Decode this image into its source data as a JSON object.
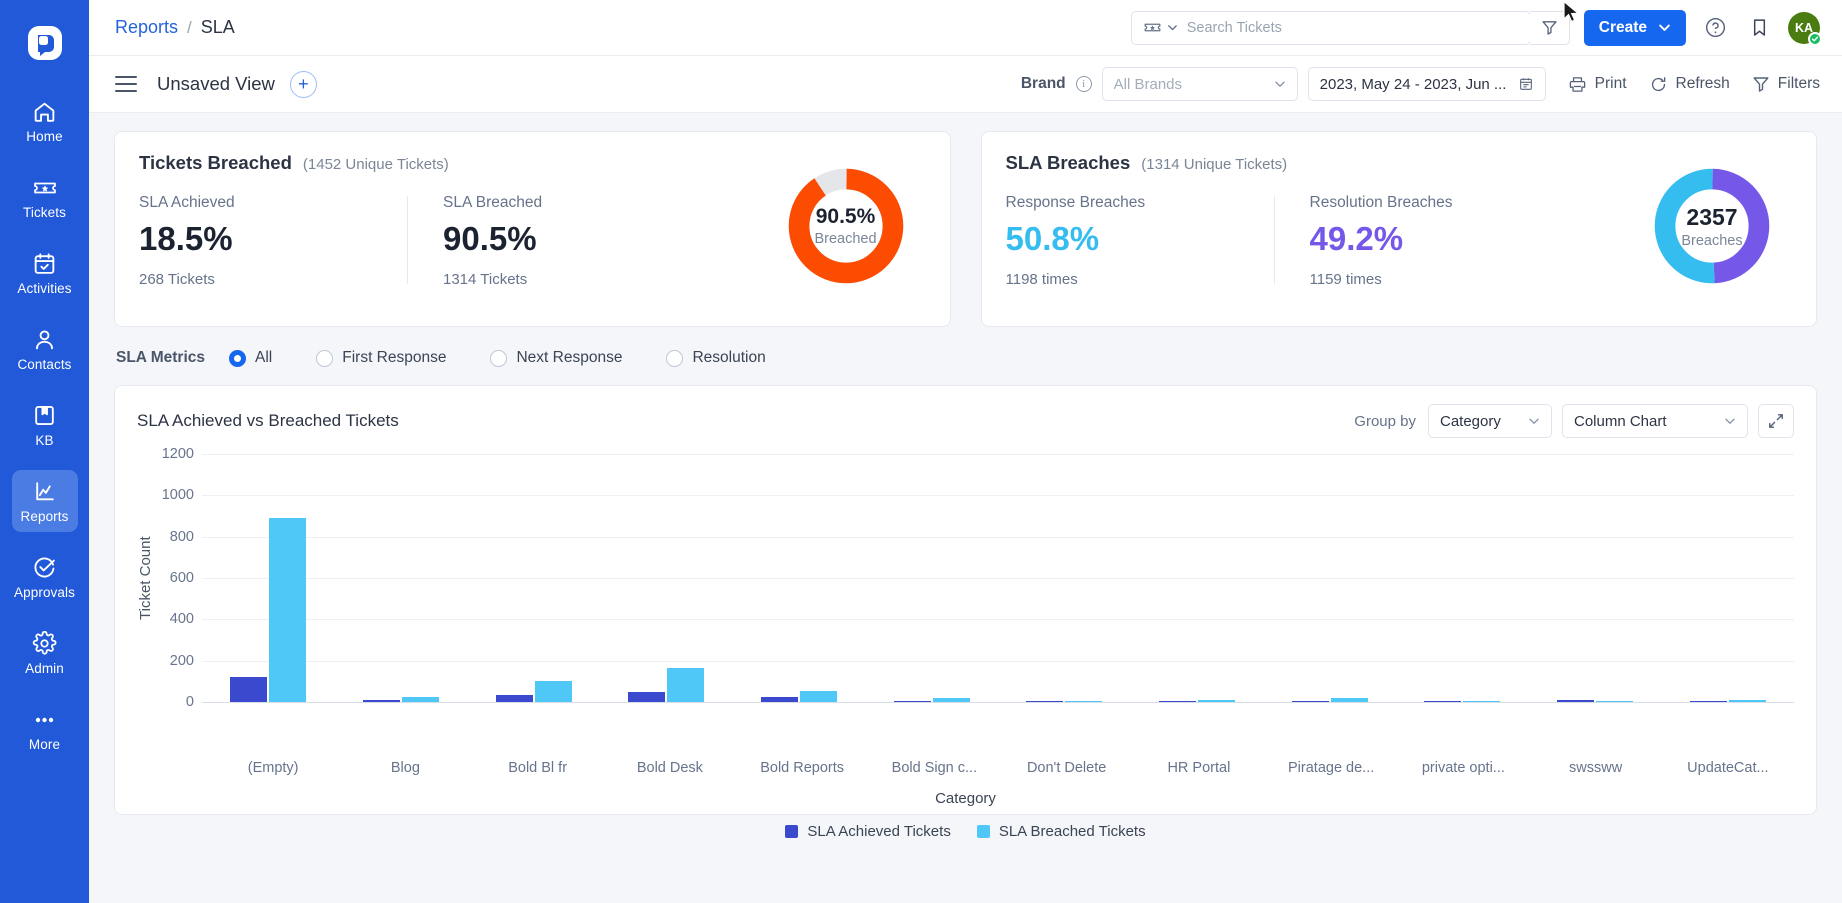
{
  "sidebar": {
    "logo_name": "boldesk-logo",
    "items": [
      {
        "label": "Home",
        "icon": "home-icon",
        "active": false
      },
      {
        "label": "Tickets",
        "icon": "ticket-icon",
        "active": false
      },
      {
        "label": "Activities",
        "icon": "calendar-check-icon",
        "active": false
      },
      {
        "label": "Contacts",
        "icon": "person-icon",
        "active": false
      },
      {
        "label": "KB",
        "icon": "book-icon",
        "active": false
      },
      {
        "label": "Reports",
        "icon": "chart-line-icon",
        "active": true
      },
      {
        "label": "Approvals",
        "icon": "check-circle-icon",
        "active": false
      },
      {
        "label": "Admin",
        "icon": "gear-icon",
        "active": false
      },
      {
        "label": "More",
        "icon": "ellipsis-icon",
        "active": false
      }
    ]
  },
  "header": {
    "breadcrumb_parent": "Reports",
    "breadcrumb_sep": "/",
    "breadcrumb_current": "SLA",
    "search": {
      "placeholder": "Search Tickets",
      "value": "",
      "type_icon": "ticket-icon",
      "chevron_icon": "chevron-down-icon",
      "filter_icon": "funnel-icon"
    },
    "create_label": "Create",
    "create_chevron_icon": "chevron-down-icon",
    "help_icon": "question-circle-icon",
    "bookmark_icon": "bookmark-icon",
    "avatar_initials": "KA",
    "avatar_status": "online"
  },
  "toolbar": {
    "menu_icon": "hamburger-icon",
    "view_name": "Unsaved View",
    "add_view_label": "+",
    "brand_label": "Brand",
    "brand_info_icon": "info-icon",
    "brand_select_placeholder": "All Brands",
    "brand_select_value": "",
    "date_range_value": "2023, May 24 - 2023, Jun ...",
    "calendar_icon": "calendar-icon",
    "print_label": "Print",
    "print_icon": "printer-icon",
    "refresh_label": "Refresh",
    "refresh_icon": "refresh-icon",
    "filters_label": "Filters",
    "filters_icon": "funnel-icon"
  },
  "cards": [
    {
      "title": "Tickets Breached",
      "subtitle": "(1452 Unique Tickets)",
      "metrics": [
        {
          "label": "SLA Achieved",
          "value": "18.5%",
          "sub": "268 Tickets",
          "color": "#1b2230"
        },
        {
          "label": "SLA Breached",
          "value": "90.5%",
          "sub": "1314 Tickets",
          "color": "#1b2230"
        }
      ],
      "donut": {
        "center_value": "90.5%",
        "center_label": "Breached",
        "segments": [
          {
            "name": "Breached",
            "percent": 90.5,
            "color": "#fc4c02"
          },
          {
            "name": "Remaining",
            "percent": 9.5,
            "color": "#e4e6e9"
          }
        ]
      }
    },
    {
      "title": "SLA Breaches",
      "subtitle": "(1314 Unique Tickets)",
      "metrics": [
        {
          "label": "Response Breaches",
          "value": "50.8%",
          "sub": "1198 times",
          "color": "#35bdf0"
        },
        {
          "label": "Resolution Breaches",
          "value": "49.2%",
          "sub": "1159 times",
          "color": "#7658e8"
        }
      ],
      "donut": {
        "center_value": "2357",
        "center_label": "Breaches",
        "segments": [
          {
            "name": "Resolution Breaches",
            "percent": 49.2,
            "color": "#7658e8"
          },
          {
            "name": "Response Breaches",
            "percent": 50.8,
            "color": "#35bdf0"
          }
        ]
      }
    }
  ],
  "sla_metrics": {
    "title": "SLA Metrics",
    "options": [
      {
        "label": "All",
        "selected": true
      },
      {
        "label": "First Response",
        "selected": false
      },
      {
        "label": "Next Response",
        "selected": false
      },
      {
        "label": "Resolution",
        "selected": false
      }
    ]
  },
  "chart_panel": {
    "title": "SLA Achieved vs Breached Tickets",
    "groupby_label": "Group by",
    "groupby_value": "Category",
    "charttype_value": "Column Chart",
    "expand_icon": "expand-diagonal-icon",
    "chevron_icon": "chevron-down-icon"
  },
  "chart_data": {
    "type": "bar",
    "title": "SLA Achieved vs Breached Tickets",
    "xlabel": "Category",
    "ylabel": "Ticket Count",
    "ylim": [
      0,
      1200
    ],
    "yticks": [
      0,
      200,
      400,
      600,
      800,
      1000,
      1200
    ],
    "grid": true,
    "legend_position": "bottom",
    "categories": [
      "(Empty)",
      "Blog",
      "Bold Bl fr",
      "Bold Desk",
      "Bold Reports",
      "Bold Sign c...",
      "Don't Delete",
      "HR Portal",
      "Piratage de...",
      "private opti...",
      "swssww",
      "UpdateCat..."
    ],
    "series": [
      {
        "name": "SLA Achieved Tickets",
        "color": "#3b49cf",
        "values": [
          120,
          11,
          33,
          49,
          26,
          6,
          3,
          7,
          5,
          2,
          12,
          1
        ]
      },
      {
        "name": "SLA Breached Tickets",
        "color": "#4fc8f7",
        "values": [
          890,
          22,
          100,
          166,
          54,
          21,
          7,
          12,
          20,
          4,
          5,
          10
        ]
      }
    ]
  }
}
